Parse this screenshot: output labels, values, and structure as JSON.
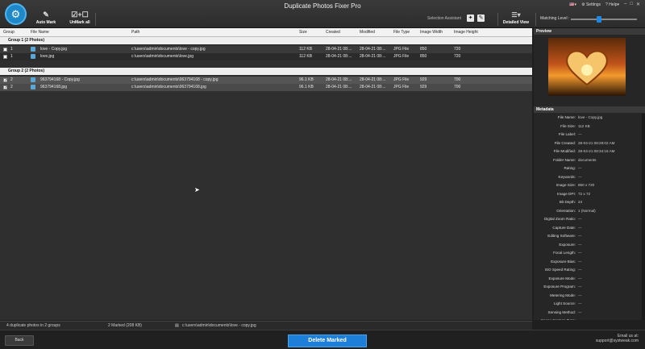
{
  "app": {
    "title": "Duplicate Photos Fixer Pro"
  },
  "toolbar": {
    "auto_mark": "Auto Mark",
    "unmark_all": "UnMark all",
    "selection_assistant": "Selection Assistant",
    "detailed_view": "Detailed View",
    "matching_level": "Matching Level :",
    "settings": "Settings",
    "help": "Help"
  },
  "columns": [
    "Group",
    "File Name",
    "Path",
    "Size",
    "Created",
    "Modified",
    "File Type",
    "Image Width",
    "Image Height"
  ],
  "groups": [
    {
      "title": "Group 1  (2 Photos)",
      "rows": [
        {
          "group": "1",
          "name": "love - Copy.jpg",
          "path": "c:\\users\\admin\\documents\\love - copy.jpg",
          "size": "112 KB",
          "created": "28-04-21 08:...",
          "modified": "28-04-21 08:...",
          "type": "JPG File",
          "width": "850",
          "height": "720",
          "marked": false
        },
        {
          "group": "1",
          "name": "love.jpg",
          "path": "c:\\users\\admin\\documents\\love.jpg",
          "size": "112 KB",
          "created": "28-04-21 08:...",
          "modified": "28-04-21 08:...",
          "type": "JPG File",
          "width": "850",
          "height": "720",
          "marked": false
        }
      ]
    },
    {
      "title": "Group 2  (2 Photos)",
      "rows": [
        {
          "group": "2",
          "name": "963794168 - Copy.jpg",
          "path": "c:\\users\\admin\\documents\\963794168 - copy.jpg",
          "size": "96.1 KB",
          "created": "28-04-21 08:...",
          "modified": "28-04-21 08:...",
          "type": "JPG File",
          "width": "929",
          "height": "700",
          "marked": true
        },
        {
          "group": "2",
          "name": "963794168.jpg",
          "path": "c:\\users\\admin\\documents\\963794168.jpg",
          "size": "96.1 KB",
          "created": "28-04-21 08:...",
          "modified": "28-04-21 08:...",
          "type": "JPG File",
          "width": "929",
          "height": "700",
          "marked": true
        }
      ]
    }
  ],
  "preview": {
    "title": "Preview"
  },
  "metadata": {
    "title": "Metadata",
    "items": [
      {
        "k": "File Name:",
        "v": "love - Copy.jpg"
      },
      {
        "k": "File Size:",
        "v": "112 KB"
      },
      {
        "k": "File Label:",
        "v": "---"
      },
      {
        "k": "File Created:",
        "v": "28-04-21 08:28:02 AM"
      },
      {
        "k": "File Modified:",
        "v": "28-04-21 08:34:16 AM"
      },
      {
        "k": "Folder Name:",
        "v": "documents"
      },
      {
        "k": "Rating:",
        "v": "---"
      },
      {
        "k": "Keywords:",
        "v": "---"
      },
      {
        "k": "Image Size:",
        "v": "850 x 720"
      },
      {
        "k": "Image DPI:",
        "v": "72 x 72"
      },
      {
        "k": "Bit Depth:",
        "v": "24"
      },
      {
        "k": "Orientation:",
        "v": "1 (Normal)"
      },
      {
        "k": "Digital Zoom Ratio:",
        "v": "---"
      },
      {
        "k": "Capture Date:",
        "v": "---"
      },
      {
        "k": "Editing Software:",
        "v": "---"
      },
      {
        "k": "Exposure:",
        "v": "---"
      },
      {
        "k": "Focal Length:",
        "v": "---"
      },
      {
        "k": "Exposure Bias:",
        "v": "---"
      },
      {
        "k": "ISO Speed Rating:",
        "v": "---"
      },
      {
        "k": "Exposure Mode:",
        "v": "---"
      },
      {
        "k": "Exposure Program:",
        "v": "---"
      },
      {
        "k": "Metering Mode:",
        "v": "---"
      },
      {
        "k": "Light Source:",
        "v": "---"
      },
      {
        "k": "Sensing Method:",
        "v": "---"
      },
      {
        "k": "Scene Capture Type:",
        "v": "---"
      }
    ]
  },
  "status": {
    "summary": "4 duplicate photos in 2 groups",
    "marked": "2 Marked (208 KB)",
    "path": "c:\\users\\admin\\documents\\love - copy.jpg"
  },
  "footer": {
    "back": "Back",
    "delete": "Delete Marked",
    "email_label": "Email us at:",
    "email": "support@systweak.com"
  },
  "colors": {
    "accent": "#1e7fd8",
    "background": "#2f2f2f"
  }
}
